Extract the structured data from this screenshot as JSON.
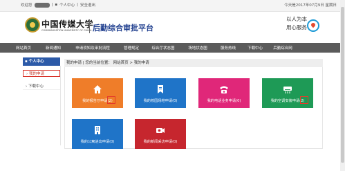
{
  "topbar": {
    "welcome": "欢迎您",
    "personal_center": "个人中心",
    "logout": "安全退出",
    "date": "今天是2017年07月9日 星期日"
  },
  "header": {
    "school_cn": "中国传媒大学",
    "school_en": "COMMUNICATION UNIVERSITY OF CHINA",
    "system_title": "后勤综合审批平台",
    "slogan_line1": "以人为本",
    "slogan_line2": "用心服务"
  },
  "nav": {
    "items": [
      "网站首页",
      "新闻通知",
      "申请须知及审批流程",
      "管理规定",
      "综合厅状态图",
      "场地状态图",
      "服务热线",
      "下载中心",
      "后勤综合网"
    ]
  },
  "sidebar": {
    "heading": "个人中心",
    "items": [
      {
        "label": "我的申请",
        "active": true
      },
      {
        "label": "下载中心",
        "active": false
      }
    ]
  },
  "breadcrumb": {
    "current": "我的申请",
    "location_prefix": "您的当前位置：",
    "home": "网站首页",
    "sep": ">",
    "page": "我的申请"
  },
  "tiles": [
    {
      "label": "我的报告厅申请",
      "count": "(2)",
      "color": "#ef7d29",
      "icon": "house-icon"
    },
    {
      "label": "我的校园场地申请",
      "count": "(0)",
      "color": "#1f74c8",
      "icon": "bookmark-icon"
    },
    {
      "label": "我的电话业务申请",
      "count": "(0)",
      "color": "#e02779",
      "icon": "telephone-icon"
    },
    {
      "label": "我的空调安装申请",
      "count": "(2)",
      "color": "#1e9a56",
      "icon": "air-conditioner-icon"
    },
    {
      "label": "我的公寓进出申请",
      "count": "(0)",
      "color": "#1f74c8",
      "icon": "building-icon"
    },
    {
      "label": "我的新闻采访申请",
      "count": "(0)",
      "color": "#c6262e",
      "icon": "camera-icon"
    }
  ]
}
